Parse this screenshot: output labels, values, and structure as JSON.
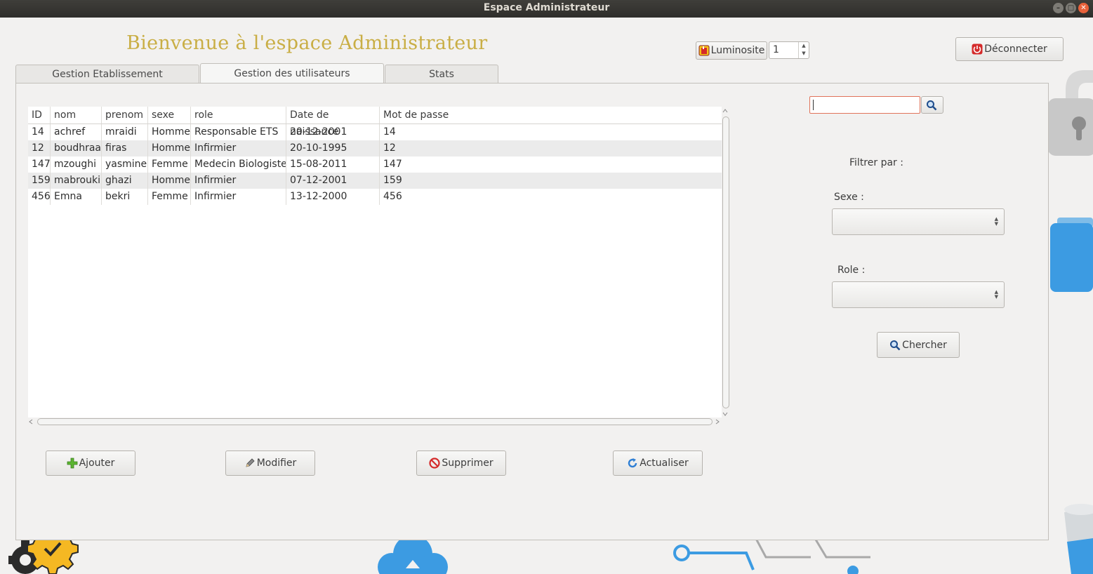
{
  "window": {
    "title": "Espace Administrateur"
  },
  "header": {
    "welcome": "Bienvenue à l'espace Administrateur",
    "brightness_label": "Luminosite",
    "brightness_value": "1",
    "logout_label": "Déconnecter"
  },
  "tabs": [
    {
      "label": "Gestion Etablissement",
      "active": false
    },
    {
      "label": "Gestion des utilisateurs",
      "active": true
    },
    {
      "label": "Stats",
      "active": false
    }
  ],
  "table": {
    "columns": [
      "ID",
      "nom",
      "prenom",
      "sexe",
      "role",
      "Date de naissance",
      "Mot de passe"
    ],
    "rows": [
      [
        "14",
        "achref",
        "mraidi",
        "Homme",
        "Responsable ETS",
        "20-12-2001",
        "14"
      ],
      [
        "12",
        "boudhraa",
        "firas",
        "Homme",
        "Infirmier",
        "20-10-1995",
        "12"
      ],
      [
        "147",
        "mzoughi",
        "yasmine",
        "Femme",
        "Medecin Biologiste",
        "15-08-2011",
        "147"
      ],
      [
        "159",
        "mabrouki",
        "ghazi",
        "Homme",
        "Infirmier",
        "07-12-2001",
        "159"
      ],
      [
        "456",
        "Emna",
        "bekri",
        "Femme",
        "Infirmier",
        "13-12-2000",
        "456"
      ]
    ]
  },
  "actions": {
    "add": "Ajouter",
    "edit": "Modifier",
    "delete": "Supprimer",
    "refresh": "Actualiser"
  },
  "filters": {
    "search_value": "",
    "title": "Filtrer par :",
    "sex_label": "Sexe :",
    "sex_value": "",
    "role_label": "Role :",
    "role_value": "",
    "search_button": "Chercher"
  },
  "colors": {
    "title_gold": "#c9ae45",
    "accent_blue": "#3c9be2",
    "search_border": "#e0735a"
  }
}
